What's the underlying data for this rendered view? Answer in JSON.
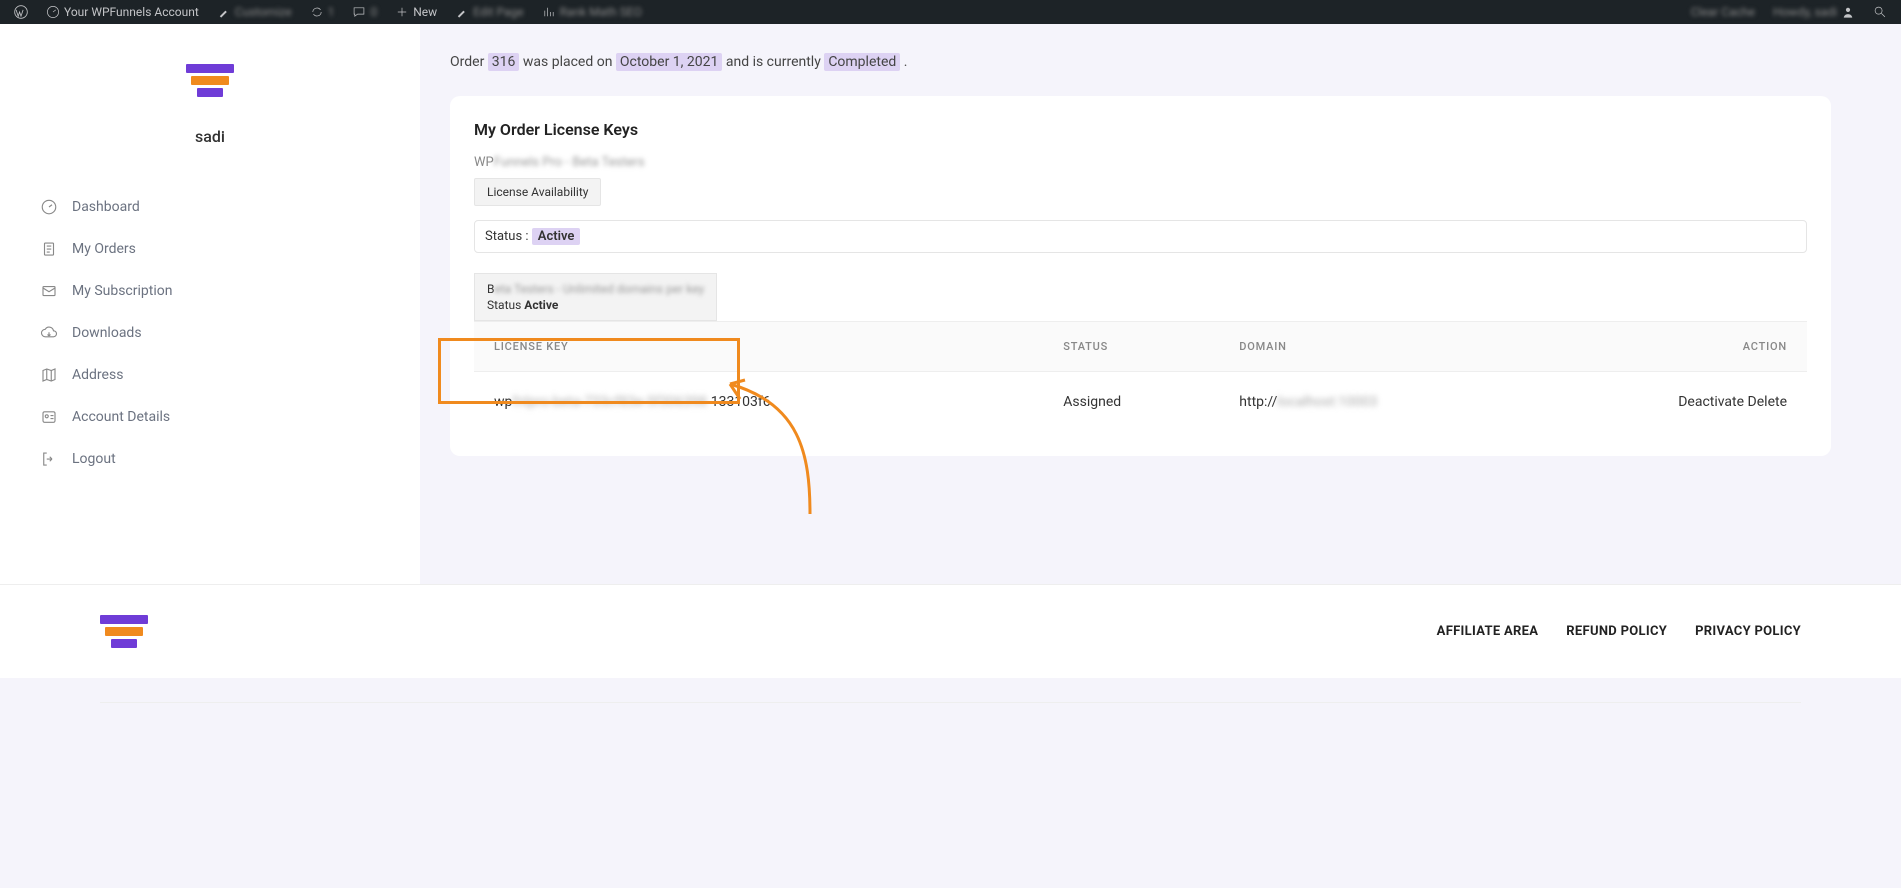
{
  "adminbar": {
    "site_title": "Your WPFunnels Account",
    "customize": "Customize",
    "updates": "1",
    "comments": "0",
    "new": "New",
    "edit": "Edit Page",
    "rankmath": "Rank Math SEO",
    "clear_cache": "Clear Cache",
    "howdy": "Howdy, sadi"
  },
  "sidebar": {
    "user": "sadi",
    "items": [
      {
        "label": "Dashboard"
      },
      {
        "label": "My Orders"
      },
      {
        "label": "My Subscription"
      },
      {
        "label": "Downloads"
      },
      {
        "label": "Address"
      },
      {
        "label": "Account Details"
      },
      {
        "label": "Logout"
      }
    ]
  },
  "order": {
    "prefix": "Order ",
    "number": "316",
    "mid1": " was placed on ",
    "date": "October 1, 2021",
    "mid2": " and is currently ",
    "status": "Completed",
    "suffix": " ."
  },
  "card": {
    "title": "My Order License Keys",
    "product_prefix": "WP",
    "product_blur": "Funnels Pro - Beta Testers",
    "availability_btn": "License Availability",
    "status_label": "Status : ",
    "status_value": "Active",
    "mini_line1_prefix": "B",
    "mini_line1_blur": "eta Testers - Unlimited domains per key",
    "mini_status_label": "Status ",
    "mini_status_value": "Active",
    "table": {
      "headers": {
        "key": "LICENSE KEY",
        "status": "STATUS",
        "domain": "DOMAIN",
        "action": "ACTION"
      },
      "row": {
        "key_prefix": "wp",
        "key_blur": "fnlpro-beta-733cf83e-5f306398",
        "key_suffix": "-133103f6",
        "status": "Assigned",
        "domain_prefix": "http://",
        "domain_blur": "localhost:10003",
        "deactivate": "Deactivate",
        "delete": "Delete"
      }
    }
  },
  "footer": {
    "links": [
      {
        "label": "AFFILIATE AREA"
      },
      {
        "label": "REFUND POLICY"
      },
      {
        "label": "PRIVACY POLICY"
      }
    ]
  }
}
